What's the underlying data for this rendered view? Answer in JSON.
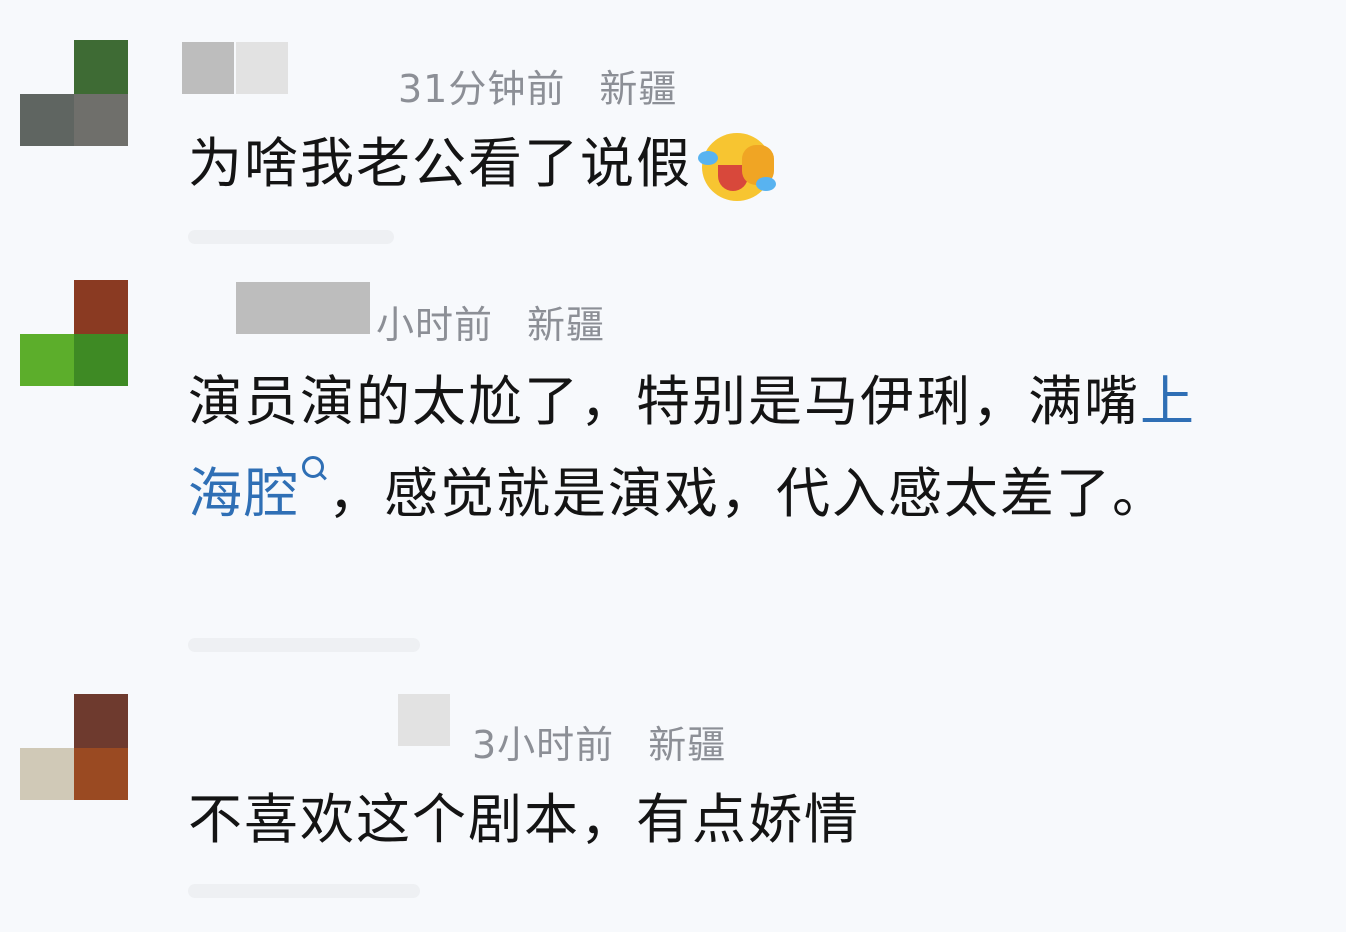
{
  "comments": [
    {
      "time": "31分钟前",
      "location": "新疆",
      "text": "为啥我老公看了说假"
    },
    {
      "time": "小时前",
      "location": "新疆",
      "text_before": "演员演的太尬了，特别是马伊琍，满嘴",
      "link": "上海腔",
      "text_after": "，感觉就是演戏，代入感太差了。"
    },
    {
      "time": "3小时前",
      "location": "新疆",
      "text": "不喜欢这个剧本，有点娇情"
    }
  ],
  "colors": {
    "link": "#2f6fb5",
    "meta": "#8c8f96",
    "text": "#141414"
  }
}
